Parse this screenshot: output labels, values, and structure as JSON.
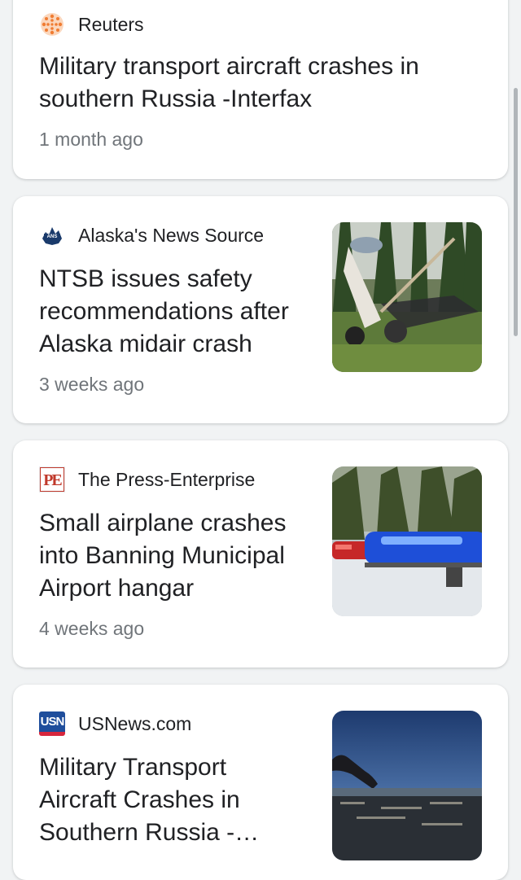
{
  "articles": [
    {
      "source": "Reuters",
      "source_icon": "reuters-logo-icon",
      "headline": "Military transport aircraft crashes in southern Russia -Interfax",
      "time": "1 month ago"
    },
    {
      "source": "Alaska's News Source",
      "source_icon": "alaskas-news-source-logo-icon",
      "headline": "NTSB issues safety recommendations after Alaska midair crash",
      "time": "3 weeks ago",
      "thumbnail": "plane-wreckage-in-woods"
    },
    {
      "source": "The Press-Enterprise",
      "source_icon": "press-enterprise-logo-icon",
      "logo_text": "PE",
      "headline": "Small airplane crashes into Banning Municipal Airport hangar",
      "time": "4 weeks ago",
      "thumbnail": "police-lightbar"
    },
    {
      "source": "USNews.com",
      "source_icon": "usnews-logo-icon",
      "logo_text": "USN",
      "headline": "Military Transport Aircraft Crashes in Southern Russia -…",
      "thumbnail": "smoke-over-city"
    }
  ],
  "colors": {
    "background": "#f1f3f4",
    "card": "#ffffff",
    "headline": "#202124",
    "timestamp": "#70757a",
    "reuters_orange": "#f07c32",
    "press_enterprise_red": "#c0392b",
    "usnews_blue": "#1f4e9c"
  }
}
